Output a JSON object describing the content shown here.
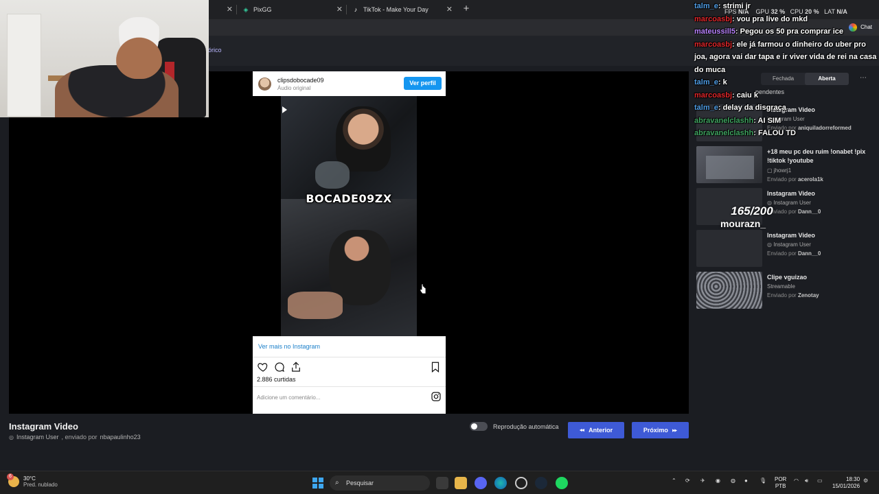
{
  "browser": {
    "tabs": [
      {
        "label": "PixGG"
      },
      {
        "label": "TikTok - Make Your Day"
      }
    ],
    "history_link": "órico"
  },
  "stream_stats": {
    "fps_label": "FPS",
    "fps": "N/A",
    "gpu_label": "GPU",
    "gpu": "32 %",
    "cpu_label": "CPU",
    "cpu": "20 %",
    "lat_label": "LAT",
    "lat": "N/A",
    "chat_button": "Chat"
  },
  "instagram": {
    "username": "clipsdobocade09",
    "audio": "Áudio original",
    "view_profile": "Ver perfil",
    "watermark": "BOCADE09ZX",
    "see_more": "Ver mais no Instagram",
    "likes": "2.886 curtidas",
    "comment_placeholder": "Adicione um comentário..."
  },
  "current_video": {
    "title": "Instagram Video",
    "source": "Instagram User",
    "sent_by_prefix": ", enviado por",
    "sent_by": "nbapaulinho23"
  },
  "controls": {
    "autoplay": "Reprodução automática",
    "prev": "Anterior",
    "next": "Próximo"
  },
  "queue_panel": {
    "tab_closed": "Fechada",
    "tab_open": "Aberta",
    "partial_row": "pendentes",
    "items": [
      {
        "title": "Instagram Video",
        "source": "Instagram User",
        "sent_prefix": "Enviado por",
        "sent_by": "aniquiladorreformed"
      },
      {
        "title": "+18 meu pc deu ruim !onabet !pix !tiktok !youtube",
        "source": "jhowrj1",
        "sent_prefix": "Enviado por",
        "sent_by": "acerola1k"
      },
      {
        "title": "Instagram Video",
        "source": "Instagram User",
        "sent_prefix": "Enviado por",
        "sent_by": "Dann__0"
      },
      {
        "title": "Instagram Video",
        "source": "Instagram User",
        "sent_prefix": "Enviado por",
        "sent_by": "Dann__0"
      },
      {
        "title": "Clipe vguizao",
        "source": "Streamable",
        "sent_prefix": "Enviado por",
        "sent_by": "Zenotay"
      }
    ],
    "goal_overlay": {
      "count": "165/200",
      "name": "mourazn_"
    }
  },
  "chat": [
    {
      "user": "talm_e",
      "color": "#4f9de6",
      "text": "strimi jr"
    },
    {
      "user": "marcoasbj",
      "color": "#e0262a",
      "text": "vou pra live do mkd"
    },
    {
      "user": "mateussill5",
      "color": "#b983ff",
      "text": "Pegou os 50 pra comprar ice"
    },
    {
      "user": "marcoasbj",
      "color": "#e0262a",
      "text": "ele já farmou o dinheiro do uber pro joa, agora vai dar tapa e ir viver vida de rei na casa do muca"
    },
    {
      "user": "talm_e",
      "color": "#4f9de6",
      "text": "k"
    },
    {
      "user": "marcoasbj",
      "color": "#e0262a",
      "text": "caiu k"
    },
    {
      "user": "talm_e",
      "color": "#4f9de6",
      "text": "delay da disgraça"
    },
    {
      "user": "abravanelclashh",
      "color": "#3fa360",
      "text": "AI SIM"
    },
    {
      "user": "abravanelclashh",
      "color": "#3fa360",
      "text": "FALOU TD"
    }
  ],
  "taskbar": {
    "temperature": "30°C",
    "weather": "Pred. nublado",
    "weather_badge": "6",
    "search": "Pesquisar",
    "lang1": "POR",
    "lang2": "PTB",
    "time": "18:30",
    "date": "15/01/2026"
  }
}
